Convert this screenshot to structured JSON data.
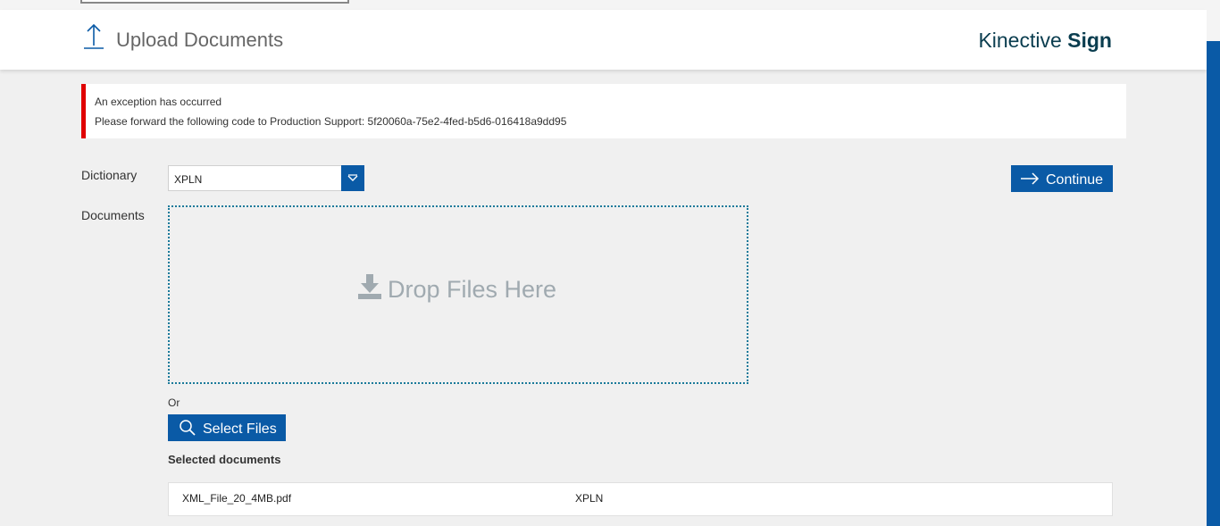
{
  "header": {
    "title": "Upload Documents",
    "brand_light": "Kinective",
    "brand_bold": "Sign",
    "icon": "upload-arrow-icon"
  },
  "alert": {
    "line1": "An exception has occurred",
    "line2": "Please forward the following code to Production Support: 5f20060a-75e2-4fed-b5d6-016418a9dd95",
    "color": "#e00000"
  },
  "form": {
    "dictionary_label": "Dictionary",
    "dictionary_value": "XPLN",
    "documents_label": "Documents",
    "continue_label": "Continue",
    "drop_text": "Drop Files Here",
    "or_text": "Or",
    "select_files_label": "Select Files"
  },
  "selected": {
    "heading": "Selected documents",
    "rows": [
      {
        "filename": "XML_File_20_4MB.pdf",
        "dictionary": "XPLN"
      }
    ]
  },
  "colors": {
    "accent": "#0a5aa6",
    "brand_text": "#0a3d4f",
    "dropzone_border": "#1a7a9a"
  }
}
